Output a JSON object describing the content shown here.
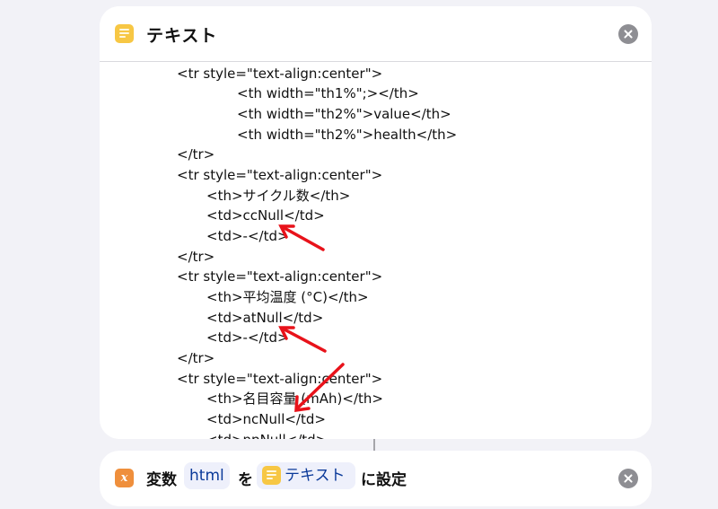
{
  "text_action": {
    "title": "テキスト",
    "icon": "note-icon",
    "code_lines": [
      "<tr style=\"text-align:center\">",
      "<th width=\"th1%\";></th>",
      "<th width=\"th2%\">value</th>",
      "<th width=\"th2%\">health</th>",
      "</tr>",
      "<tr style=\"text-align:center\">",
      "<th>サイクル数</th>",
      "<td>ccNull</td>",
      "<td>-</td>",
      "</tr>",
      "<tr style=\"text-align:center\">",
      "<th>平均温度 (°C)</th>",
      "<td>atNull</td>",
      "<td>-</td>",
      "</tr>",
      "<tr style=\"text-align:center\">",
      "<th>名目容量 (mAh)</th>",
      "<td>ncNull</td>",
      "<td>npNull</td>"
    ]
  },
  "set_variable_action": {
    "icon": "variable-icon",
    "verb": "変数",
    "variable_name": "html",
    "particle": "を",
    "value_token": "テキスト",
    "suffix": "に設定"
  },
  "colors": {
    "accent_token_text": "#0b3a9a",
    "annotation_arrow": "#e8121a",
    "note_icon": "#f7c744",
    "variable_icon": "#ef8f3c"
  }
}
